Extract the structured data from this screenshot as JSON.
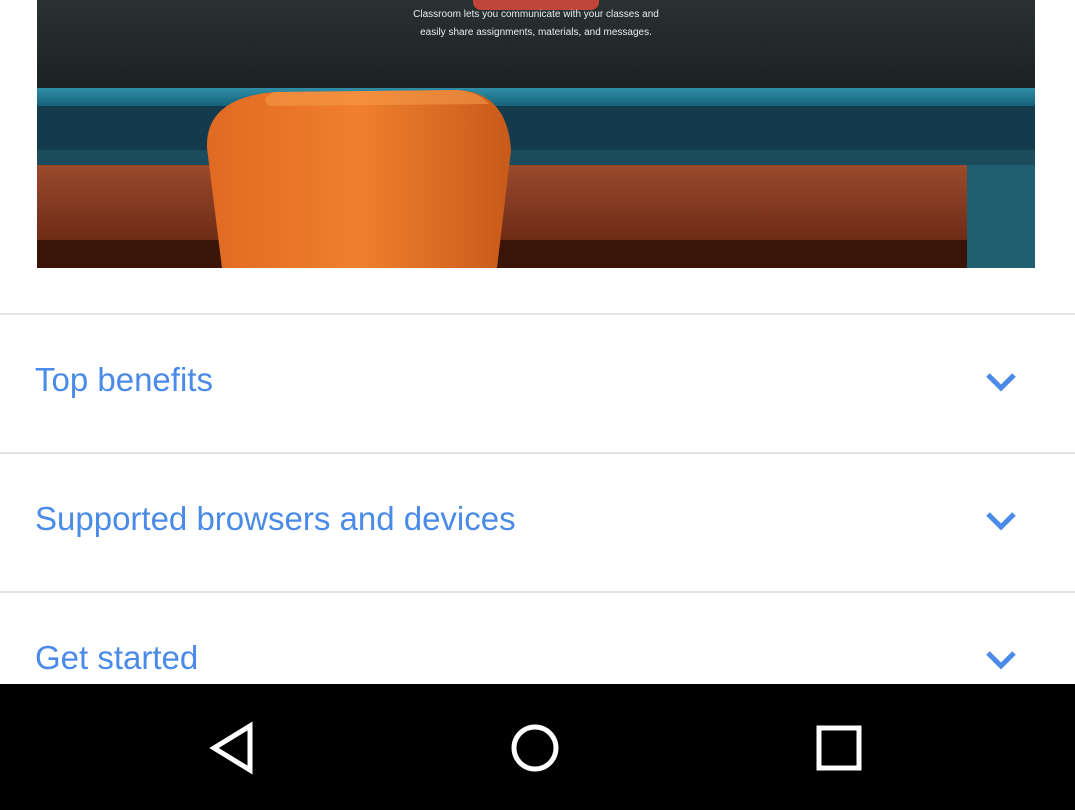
{
  "hero": {
    "caption_line1": "Classroom lets you communicate with your classes and",
    "caption_line2": "easily share assignments, materials, and messages."
  },
  "accordion": {
    "items": [
      {
        "label": "Top benefits",
        "icon": "chevron-down-icon"
      },
      {
        "label": "Supported browsers and devices",
        "icon": "chevron-down-icon"
      },
      {
        "label": "Get started",
        "icon": "chevron-down-icon"
      }
    ]
  },
  "navbar": {
    "buttons": [
      {
        "icon": "back-triangle-icon"
      },
      {
        "icon": "home-circle-icon"
      },
      {
        "icon": "recents-square-icon"
      }
    ]
  },
  "colors": {
    "link_blue": "#4a8ae8",
    "divider": "#e3e3e3",
    "navbar_bg": "#000000"
  }
}
